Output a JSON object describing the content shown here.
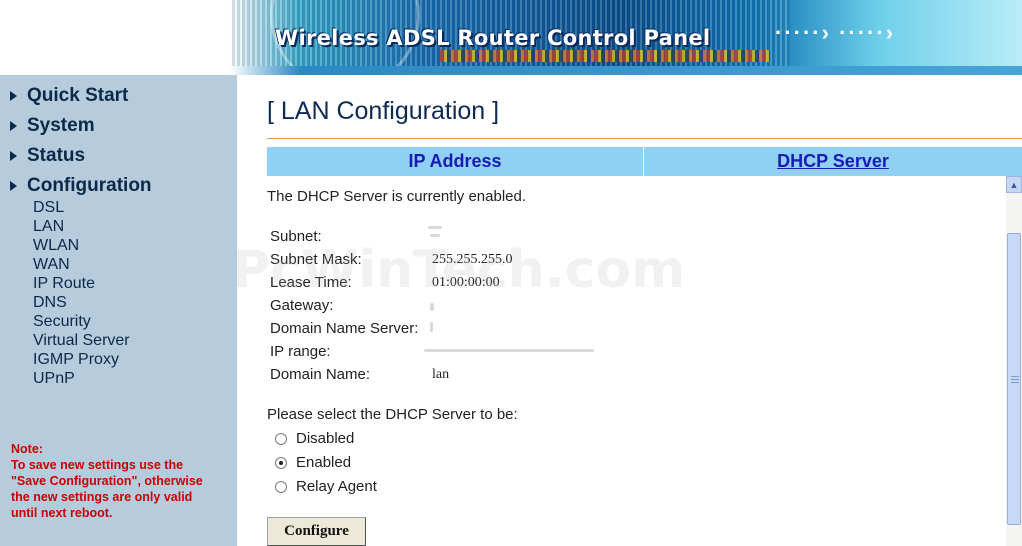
{
  "header": {
    "title": "Wireless ADSL Router Control Panel",
    "arrows": "·····› ·····›"
  },
  "sidebar": {
    "main_items": [
      {
        "label": "Quick Start"
      },
      {
        "label": "System"
      },
      {
        "label": "Status"
      },
      {
        "label": "Configuration"
      }
    ],
    "sub_items": [
      {
        "label": "DSL"
      },
      {
        "label": "LAN"
      },
      {
        "label": "WLAN"
      },
      {
        "label": "WAN"
      },
      {
        "label": "IP Route"
      },
      {
        "label": "DNS"
      },
      {
        "label": "Security"
      },
      {
        "label": "Virtual Server"
      },
      {
        "label": "IGMP Proxy"
      },
      {
        "label": "UPnP"
      }
    ],
    "note": {
      "heading": "Note:",
      "line1": "To save new settings use the",
      "line2": "\"Save Configuration\", otherwise",
      "line3": "the new settings are only valid",
      "line4": "until next reboot."
    }
  },
  "main": {
    "page_title": "[ LAN Configuration ]",
    "tabs": [
      {
        "label": "IP Address"
      },
      {
        "label": "DHCP Server"
      }
    ],
    "status_text": "The DHCP Server is currently enabled.",
    "info": [
      {
        "label": "Subnet:",
        "value": ""
      },
      {
        "label": "Subnet Mask:",
        "value": "255.255.255.0"
      },
      {
        "label": "Lease Time:",
        "value": "01:00:00:00"
      },
      {
        "label": "Gateway:",
        "value": ""
      },
      {
        "label": "Domain Name Server:",
        "value": ""
      },
      {
        "label": "IP range:",
        "value": ""
      },
      {
        "label": "Domain Name:",
        "value": "lan"
      }
    ],
    "select_text": "Please select the DHCP Server to be:",
    "options": [
      {
        "label": "Disabled",
        "checked": false
      },
      {
        "label": "Enabled",
        "checked": true
      },
      {
        "label": "Relay Agent",
        "checked": false
      }
    ],
    "configure_label": "Configure"
  },
  "watermark": "PcWinTech.com",
  "colors": {
    "sidebar_bg": "#b6cbdc",
    "tab_bg": "#8fd0f4",
    "tab_text": "#1a1ab4",
    "note_text": "#cc0000",
    "title_rule": "#e4a05a"
  }
}
